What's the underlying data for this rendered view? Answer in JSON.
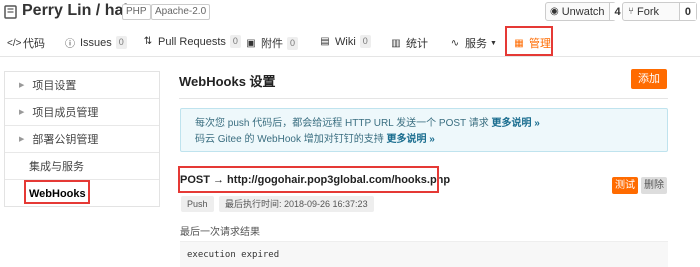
{
  "header": {
    "repo_title": "Perry Lin / hairs",
    "language_badge": "PHP",
    "license_badge": "Apache-2.0",
    "unwatch": {
      "label": "Unwatch",
      "count": "4"
    },
    "fork": {
      "label": "Fork",
      "count": "0"
    }
  },
  "tabs": [
    {
      "icon": "code-icon",
      "label": "代码"
    },
    {
      "icon": "issues-icon",
      "label": "Issues",
      "count": "0"
    },
    {
      "icon": "pull-request-icon",
      "label": "Pull Requests",
      "count": "0"
    },
    {
      "icon": "attachment-icon",
      "label": "附件",
      "count": "0"
    },
    {
      "icon": "wiki-icon",
      "label": "Wiki",
      "count": "0"
    },
    {
      "icon": "stats-icon",
      "label": "统计"
    },
    {
      "icon": "service-icon",
      "label": "服务"
    },
    {
      "icon": "manage-icon",
      "label": "管理"
    }
  ],
  "sidebar": {
    "items": [
      {
        "label": "项目设置"
      },
      {
        "label": "项目成员管理"
      },
      {
        "label": "部署公钥管理"
      },
      {
        "label": "集成与服务"
      },
      {
        "label": "WebHooks"
      }
    ]
  },
  "main": {
    "title": "WebHooks 设置",
    "add_label": "添加",
    "info_line1": "每次您 push 代码后，都会给远程 HTTP URL 发送一个 POST 请求",
    "info_line1_more": "更多说明 »",
    "info_line2": "码云 Gitee 的 WebHook 增加对钉钉的支持",
    "info_line2_more": "更多说明 »",
    "hook": {
      "url_text": "POST → http://gogohair.pop3global.com/hooks.php",
      "test_label": "测试",
      "delete_label": "删除",
      "event_tag": "Push",
      "last_exec": "最后执行时间: 2018-09-26 16:37:23",
      "last_result_label": "最后一次请求结果",
      "last_result": "execution expired"
    }
  },
  "colors": {
    "accent": "#ff6b00",
    "highlight": "#e53935",
    "info_bg": "#eef8fb"
  }
}
